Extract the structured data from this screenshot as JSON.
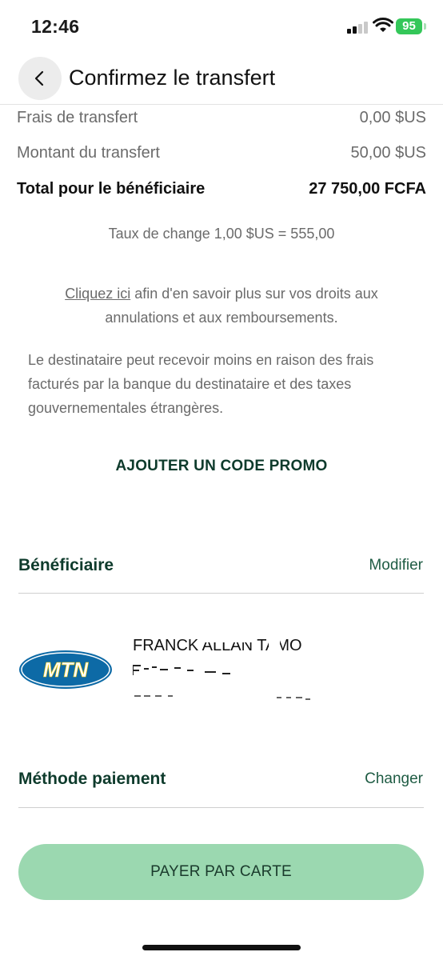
{
  "status_bar": {
    "time": "12:46",
    "battery": "95"
  },
  "header": {
    "title": "Confirmez le transfert"
  },
  "summary": {
    "rows": [
      {
        "label": "Frais de transfert",
        "value": "0,00 $US"
      },
      {
        "label": "Montant du transfert",
        "value": "50,00 $US"
      },
      {
        "label": "Total pour le bénéficiaire",
        "value": "27 750,00 FCFA"
      }
    ],
    "exchange_rate": "Taux de change 1,00 $US = 555,00"
  },
  "info": {
    "link_text": "Cliquez ici",
    "link_rest": " afin d'en savoir plus sur vos droits aux annulations et aux remboursements.",
    "disclaimer": "Le destinataire peut recevoir moins en raison des frais facturés par la banque du destinataire et des taxes gouvernementales étrangères."
  },
  "promo": {
    "label": "AJOUTER UN CODE PROMO"
  },
  "beneficiary": {
    "title": "Bénéficiaire",
    "action": "Modifier",
    "provider_logo_text": "MTN",
    "name": "FRANCK ALLAN TAMO"
  },
  "payment": {
    "title": "Méthode paiement",
    "action": "Changer"
  },
  "pay_button": {
    "label": "PAYER PAR CARTE"
  },
  "colors": {
    "accent_dark": "#0e3b2c",
    "button_bg": "#9bd8b0",
    "mtn_blue": "#0d6aa6",
    "mtn_yellow": "#ffcc00"
  }
}
